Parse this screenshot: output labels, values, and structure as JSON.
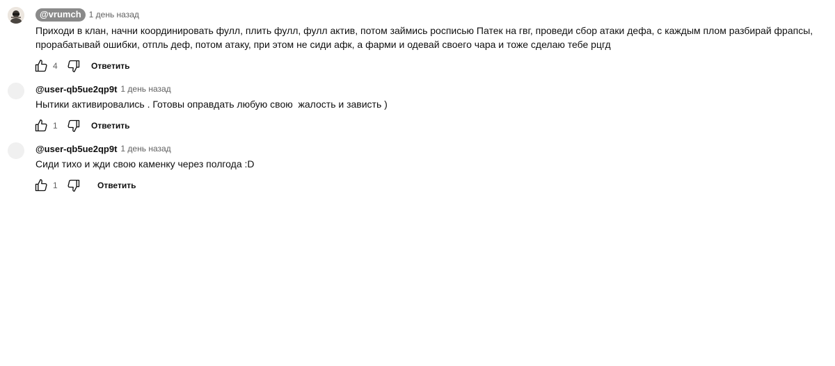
{
  "comments": [
    {
      "author": "@vrumch",
      "time": "1 день назад",
      "text": "Приходи в клан, начни координировать фулл, плить фулл, фулл актив, потом займись росписью Патек на гвг, проведи сбор атаки дефа, с каждым плом разбирай фрапсы,\nпрорабатывай ошибки, отпль деф, потом атаку, при этом не сиди афк, а фарми и одевай своего чара и тоже сделаю тебе рцгд",
      "likes": "4",
      "reply_label": "Ответить",
      "avatar": "photo-avatar"
    },
    {
      "author": "@user-qb5ue2qp9t",
      "time": "1 день назад",
      "text": "Нытики активировались . Готовы оправдать любую свою  жалость и зависть )",
      "likes": "1",
      "reply_label": "Ответить",
      "avatar": "blank-avatar"
    },
    {
      "author": "@user-qb5ue2qp9t",
      "time": "1 день назад",
      "text": "Сиди тихо и жди свою каменку через полгода :D",
      "likes": "1",
      "reply_label": "Ответить",
      "avatar": "blank-avatar"
    }
  ],
  "icons": {
    "like": "thumb-up-icon",
    "dislike": "thumb-down-icon"
  },
  "colors": {
    "author_pill": "#8a8a8a",
    "secondary_text": "#606060",
    "primary_text": "#0f0f0f"
  }
}
